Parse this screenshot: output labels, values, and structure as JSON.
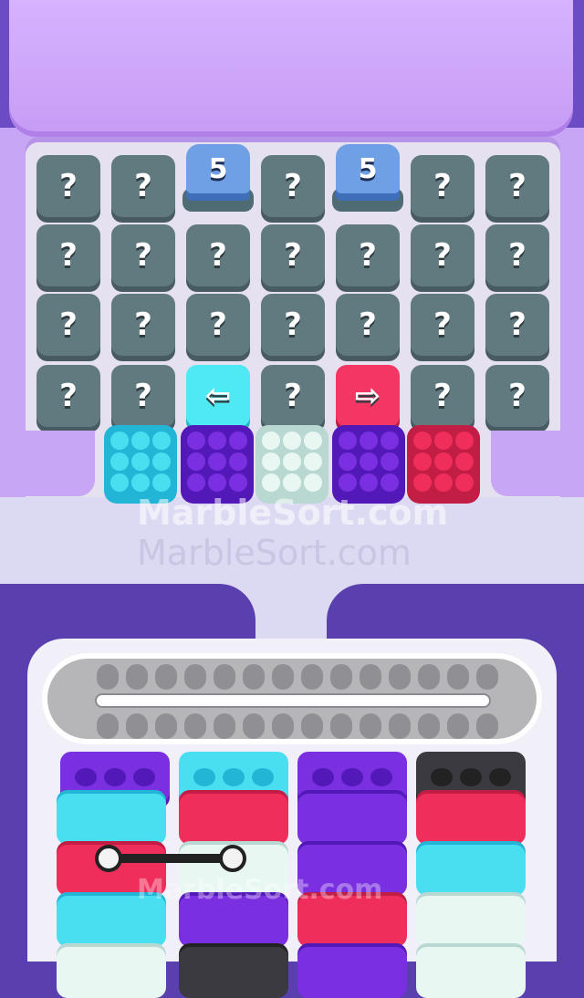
{
  "colors": {
    "cyan": "#49dff0",
    "purple": "#7a2fe0",
    "white": "#e9f7f3",
    "red": "#f02e5c",
    "dark": "#3a3a40",
    "hidden_tile": "#617a80"
  },
  "grid": {
    "count_tiles": [
      {
        "col": 2,
        "label": "5"
      },
      {
        "col": 4,
        "label": "5"
      }
    ],
    "rows": [
      [
        "?",
        "",
        "",
        "?",
        "",
        "?",
        "?"
      ],
      [
        "?",
        "?",
        "?",
        "?",
        "?",
        "?",
        "?"
      ],
      [
        "?",
        "?",
        "?",
        "?",
        "?",
        "?",
        "?"
      ],
      [
        "?",
        "?",
        "arrow-left",
        "?",
        "arrow-right",
        "?",
        "?"
      ]
    ],
    "row0_extra": [
      "?",
      "?",
      "?",
      "?",
      "?",
      "?",
      "?"
    ],
    "arrow_left_label": "⇦",
    "arrow_right_label": "⇨"
  },
  "marble_boxes": [
    "cyan",
    "purple",
    "white",
    "purple",
    "red"
  ],
  "watermark": {
    "line1": "MarbleSort.com",
    "line2": "MarbleSort.com",
    "line3": "MarbleSort.com"
  },
  "sort_columns": [
    {
      "cap": "purple",
      "blocks": [
        "cyan",
        "red",
        "cyan",
        "white"
      ]
    },
    {
      "cap": "cyan",
      "blocks": [
        "red",
        "white",
        "purple",
        "dark"
      ]
    },
    {
      "cap": "purple",
      "blocks": [
        "purple",
        "purple",
        "red",
        "purple"
      ]
    },
    {
      "cap": "dark",
      "blocks": [
        "red",
        "cyan",
        "white",
        "white"
      ]
    }
  ]
}
